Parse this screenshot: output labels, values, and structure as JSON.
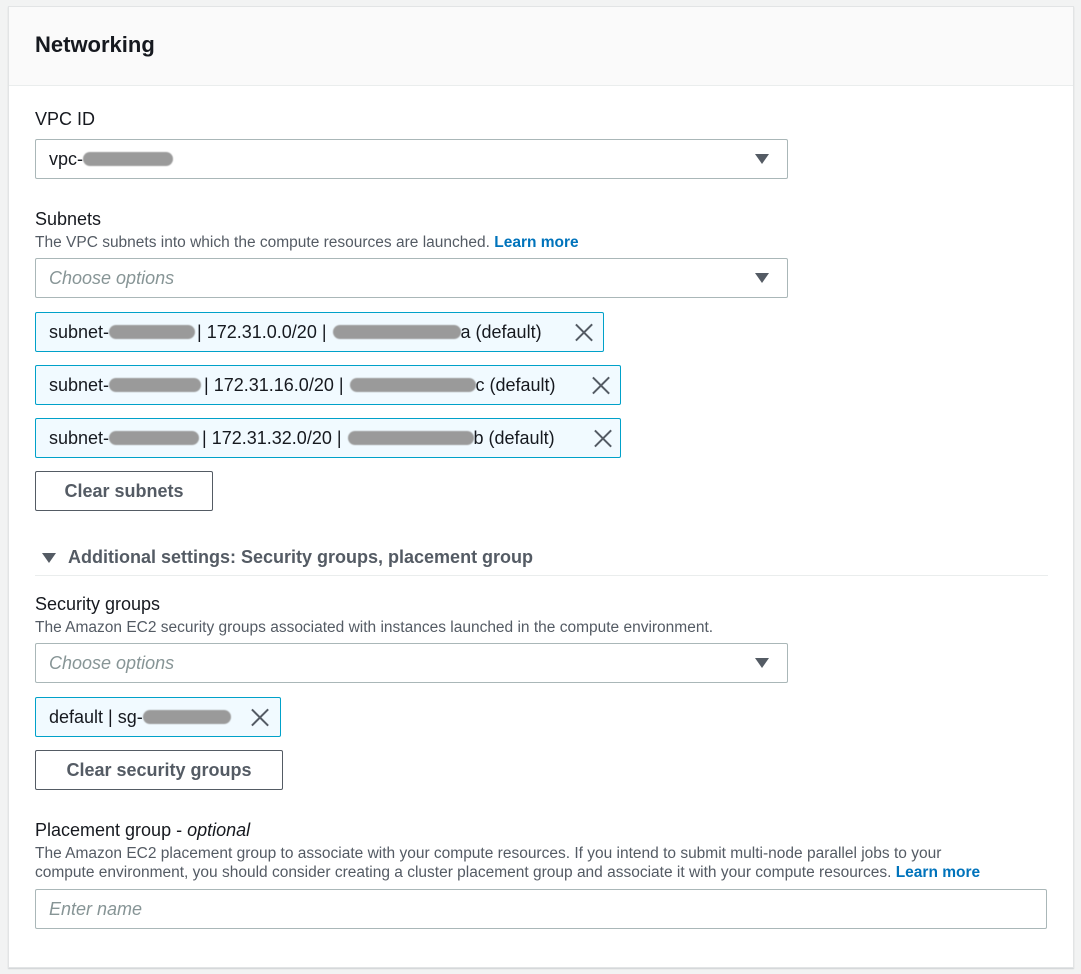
{
  "panel": {
    "title": "Networking"
  },
  "vpc": {
    "label": "VPC ID",
    "value_prefix": "vpc-"
  },
  "subnets": {
    "label": "Subnets",
    "description": "The VPC subnets into which the compute resources are launched.",
    "learn_more": "Learn more",
    "placeholder": "Choose options",
    "tokens": [
      {
        "prefix": "subnet-",
        "middle": "| 172.31.0.0/20 |",
        "suffix": "a (default)"
      },
      {
        "prefix": "subnet-",
        "middle": "| 172.31.16.0/20 |",
        "suffix": "c (default)"
      },
      {
        "prefix": "subnet-",
        "middle": "| 172.31.32.0/20 |",
        "suffix": "b (default)"
      }
    ],
    "clear_button": "Clear subnets"
  },
  "additional_settings": {
    "label": "Additional settings: Security groups, placement group"
  },
  "security_groups": {
    "label": "Security groups",
    "description": "The Amazon EC2 security groups associated with instances launched in the compute environment.",
    "placeholder": "Choose options",
    "token_prefix": "default | sg-",
    "clear_button": "Clear security groups"
  },
  "placement_group": {
    "label": "Placement group - ",
    "label_optional": "optional",
    "description_line1": "The Amazon EC2 placement group to associate with your compute resources. If you intend to submit multi-node parallel jobs to your",
    "description_line2": "compute environment, you should consider creating a cluster placement group and associate it with your compute resources.",
    "learn_more": "Learn more",
    "placeholder": "Enter name"
  },
  "colors": {
    "accent": "#0073bb",
    "token_border": "#00a1c9",
    "token_bg": "#f1faff",
    "text": "#16191f",
    "muted": "#545b64"
  }
}
